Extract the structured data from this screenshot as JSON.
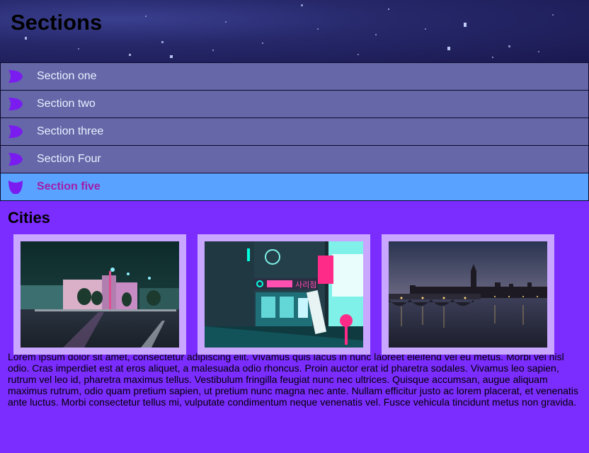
{
  "header": {
    "title": "Sections"
  },
  "accordion": {
    "items": [
      {
        "label": "Section one",
        "expanded": false
      },
      {
        "label": "Section two",
        "expanded": false
      },
      {
        "label": "Section three",
        "expanded": false
      },
      {
        "label": "Section Four",
        "expanded": false
      },
      {
        "label": "Section five",
        "expanded": true
      }
    ],
    "icon_color": "#7a1cf0",
    "active_bg": "#5aa2ff",
    "active_text_color": "#a11ea8"
  },
  "content": {
    "heading": "Cities",
    "paragraph": "Lorem ipsum dolor sit amet, consectetur adipiscing elit. Vivamus quis lacus in nunc laoreet eleifend vel eu metus. Morbi vel nisl odio. Cras imperdiet est at eros aliquet, a malesuada odio rhoncus. Proin auctor erat id pharetra sodales. Vivamus leo sapien, rutrum vel leo id, pharetra maximus tellus. Vestibulum fringilla feugiat nunc nec ultrices. Quisque accumsan, augue aliquam maximus rutrum, odio quam pretium sapien, ut pretium nunc magna nec ante. Nullam efficitur justo ac lorem placerat, et venenatis ante luctus. Morbi consectetur tellus mi, vulputate condimentum neque venenatis vel. Fusce vehicula tincidunt metus non gravida.",
    "images": [
      {
        "subject": "city street at night with neon-lit buildings"
      },
      {
        "subject": "neon street shop at night",
        "sign_text": "사리점"
      },
      {
        "subject": "Westminster bridge and Big Ben at dusk"
      }
    ]
  },
  "colors": {
    "page_bg": "#7b2cff",
    "section_bg": "#6567a8",
    "frame_bg": "#c9a6ff"
  }
}
